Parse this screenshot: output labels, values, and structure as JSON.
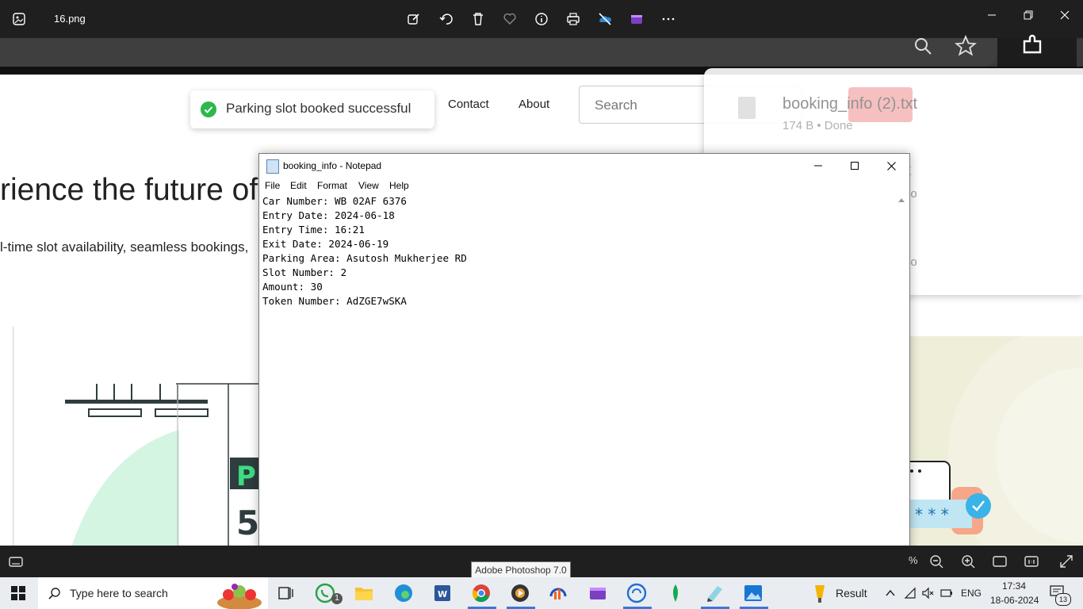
{
  "viewer": {
    "file_name": "16.png",
    "toolbar_icons": [
      "edit-icon",
      "rotate-icon",
      "delete-icon",
      "favorite-icon",
      "info-icon",
      "print-icon",
      "onedrive-icon",
      "clipchamp-icon",
      "more-icon"
    ],
    "zoom_fragment": "%"
  },
  "webpage": {
    "toast": {
      "message": "Parking slot booked successful",
      "color": "#2db84c"
    },
    "nav": {
      "contact": "Contact",
      "about": "About"
    },
    "search": {
      "placeholder": "Search"
    },
    "hero": {
      "title": "rience the future of",
      "subtitle": "l-time slot availability, seamless bookings,"
    },
    "illustration": {
      "sign_letter": "P",
      "sign_number": "5"
    }
  },
  "downloads": {
    "file_name": "booking_info (2).txt",
    "meta": "174 B • Done",
    "fragment_1": "txt",
    "fragment_2": "go",
    "fragment_3": "go"
  },
  "notepad": {
    "title": "booking_info - Notepad",
    "menu": [
      "File",
      "Edit",
      "Format",
      "View",
      "Help"
    ],
    "lines": [
      "Car Number: WB 02AF 6376",
      "Entry Date: 2024-06-18",
      "Entry Time: 16:21",
      "Exit Date: 2024-06-19",
      "Parking Area: Asutosh Mukherjee RD",
      "Slot Number: 2",
      "Amount: 30",
      "Token Number: AdZGE7wSKA"
    ]
  },
  "tooltip": "Adobe Photoshop 7.0",
  "taskbar": {
    "search_placeholder": "Type here to search",
    "whatsapp_badge": "1",
    "weather_label": "Result",
    "language": "ENG",
    "time": "17:34",
    "date": "18-06-2024",
    "notifications": "13"
  }
}
